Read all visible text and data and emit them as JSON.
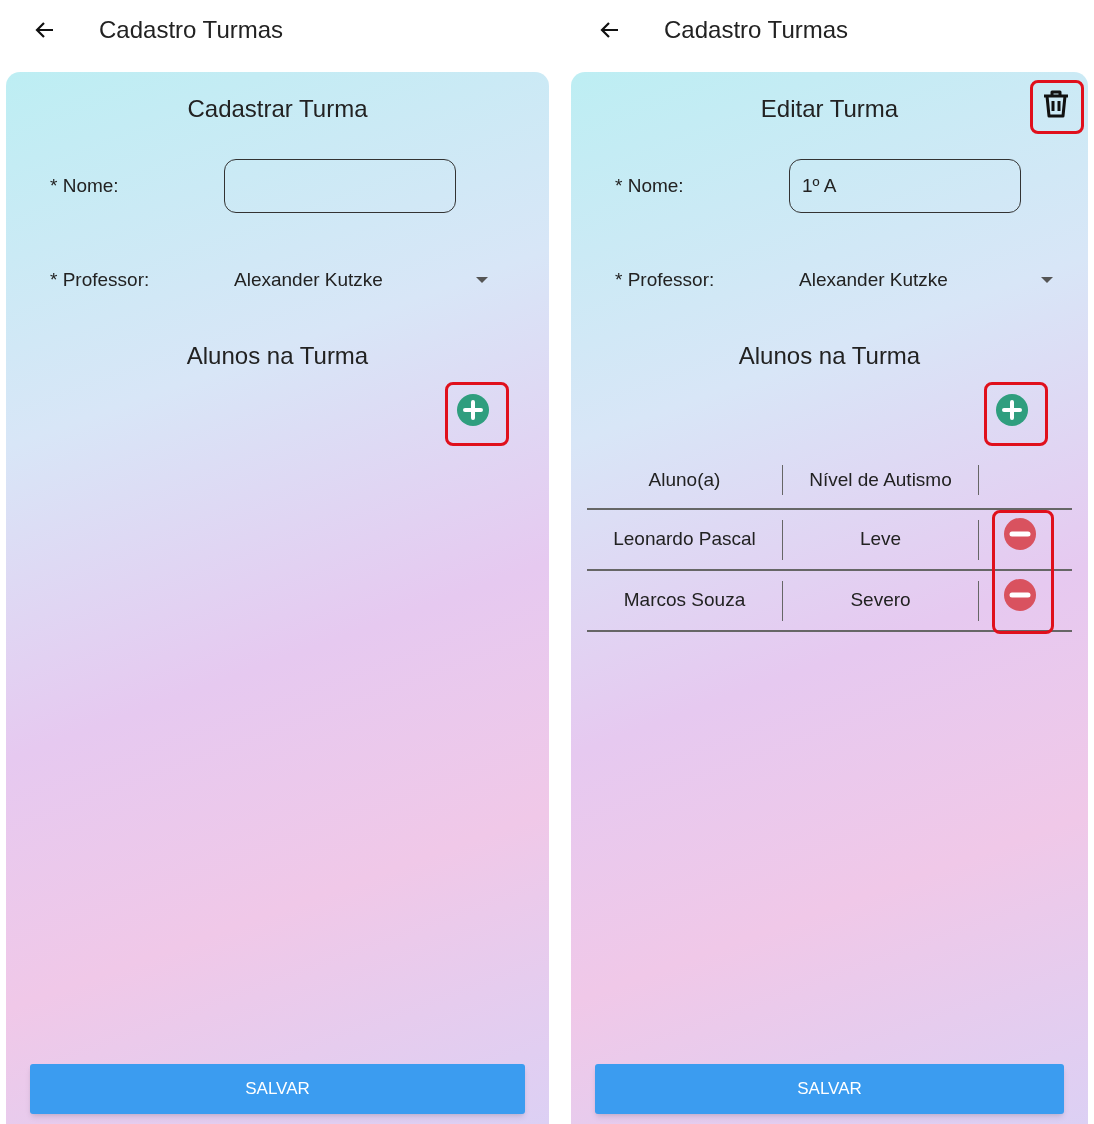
{
  "screens": [
    {
      "app_bar": {
        "title": "Cadastro Turmas"
      },
      "form_title": "Cadastrar Turma",
      "name_field": {
        "label": "* Nome:"
      },
      "professor_field": {
        "label": "* Professor:",
        "value": "Alexander Kutzke"
      },
      "section_title": "Alunos na Turma",
      "add_button": {
        "highlighted": true
      },
      "save_button": "SALVAR"
    },
    {
      "app_bar": {
        "title": "Cadastro Turmas"
      },
      "form_title": "Editar Turma",
      "delete_button": {
        "highlighted": true
      },
      "name_field": {
        "label": "* Nome:",
        "value": "1º A"
      },
      "professor_field": {
        "label": "* Professor:",
        "value": "Alexander Kutzke"
      },
      "section_title": "Alunos na Turma",
      "add_button": {
        "highlighted": true
      },
      "table": {
        "columns": [
          "Aluno(a)",
          "Nível de Autismo"
        ],
        "remove_highlighted": true,
        "rows": [
          {
            "cells": [
              "Leonardo Pascal",
              "Leve"
            ]
          },
          {
            "cells": [
              "Marcos Souza",
              "Severo"
            ]
          }
        ]
      },
      "save_button": "SALVAR"
    }
  ]
}
